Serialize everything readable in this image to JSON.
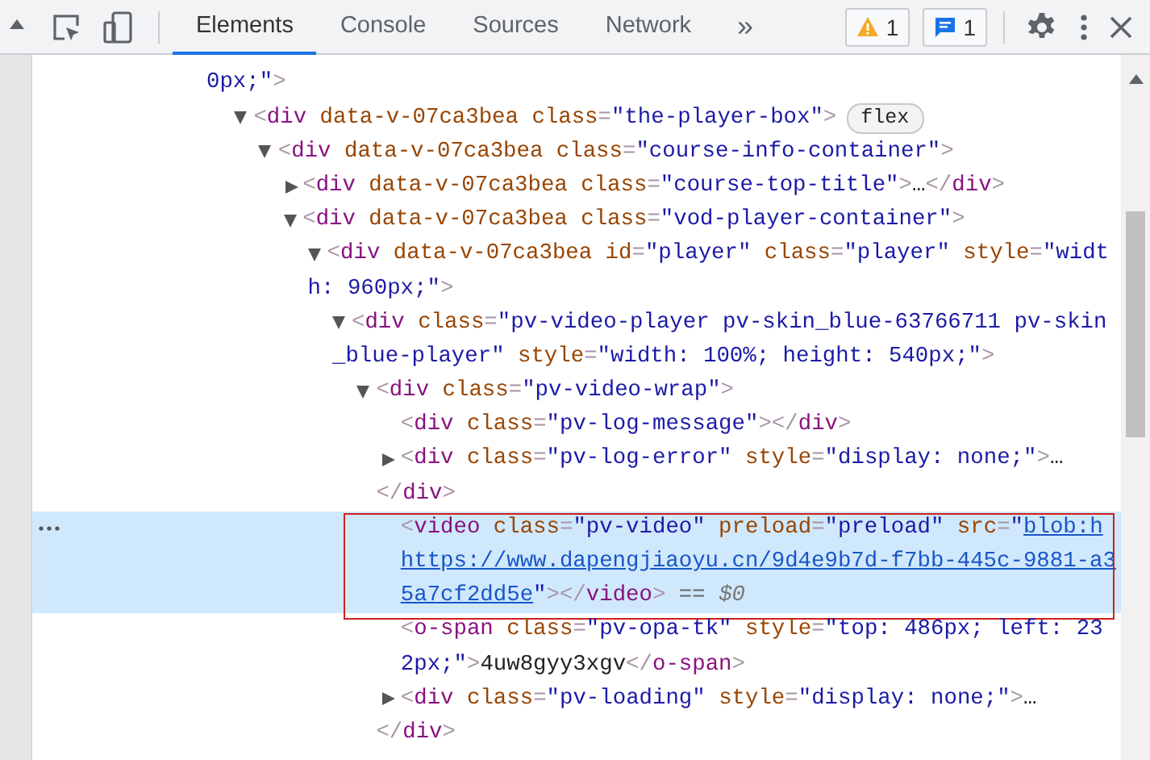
{
  "toolbar": {
    "tabs": [
      {
        "label": "Elements",
        "selected": true
      },
      {
        "label": "Console",
        "selected": false
      },
      {
        "label": "Sources",
        "selected": false
      },
      {
        "label": "Network",
        "selected": false
      }
    ],
    "more": "»",
    "warnings": "1",
    "messages": "1"
  },
  "nodes": [
    {
      "kind": "continuation",
      "selected": false,
      "lines": [
        [
          {
            "kind": "value",
            "text": "0px;\""
          },
          {
            "kind": "punct",
            "text": ">"
          }
        ]
      ],
      "children": [
        {
          "kind": "node",
          "expanded": true,
          "selected": false,
          "badge": "flex",
          "lines": [
            [
              {
                "kind": "punct",
                "text": "<"
              },
              {
                "kind": "tag",
                "text": "div"
              },
              {
                "kind": "attr",
                "text": " data-v-07ca3bea"
              },
              {
                "kind": "attr",
                "text": " class"
              },
              {
                "kind": "punct",
                "text": "="
              },
              {
                "kind": "value",
                "text": "\"the-player-box\""
              },
              {
                "kind": "punct",
                "text": ">"
              }
            ]
          ],
          "children": [
            {
              "kind": "node",
              "expanded": true,
              "selected": false,
              "lines": [
                [
                  {
                    "kind": "punct",
                    "text": "<"
                  },
                  {
                    "kind": "tag",
                    "text": "div"
                  },
                  {
                    "kind": "attr",
                    "text": " data-v-07ca3bea"
                  },
                  {
                    "kind": "attr",
                    "text": " class"
                  },
                  {
                    "kind": "punct",
                    "text": "="
                  },
                  {
                    "kind": "value",
                    "text": "\"course-info-container\""
                  },
                  {
                    "kind": "punct",
                    "text": ">"
                  }
                ]
              ],
              "children": [
                {
                  "kind": "node",
                  "expanded": false,
                  "selected": false,
                  "lines": [
                    [
                      {
                        "kind": "punct",
                        "text": "<"
                      },
                      {
                        "kind": "tag",
                        "text": "div"
                      },
                      {
                        "kind": "attr",
                        "text": " data-v-07ca3bea"
                      },
                      {
                        "kind": "attr",
                        "text": " class"
                      },
                      {
                        "kind": "punct",
                        "text": "="
                      },
                      {
                        "kind": "value",
                        "text": "\"course-top-title\""
                      },
                      {
                        "kind": "punct",
                        "text": ">"
                      },
                      {
                        "kind": "plain",
                        "text": "…"
                      },
                      {
                        "kind": "punct",
                        "text": "</"
                      },
                      {
                        "kind": "tag",
                        "text": "div"
                      },
                      {
                        "kind": "punct",
                        "text": ">"
                      }
                    ]
                  ]
                },
                {
                  "kind": "node",
                  "expanded": true,
                  "selected": false,
                  "lines": [
                    [
                      {
                        "kind": "punct",
                        "text": "<"
                      },
                      {
                        "kind": "tag",
                        "text": "div"
                      },
                      {
                        "kind": "attr",
                        "text": " data-v-07ca3bea"
                      },
                      {
                        "kind": "attr",
                        "text": " class"
                      },
                      {
                        "kind": "punct",
                        "text": "="
                      },
                      {
                        "kind": "value",
                        "text": "\"vod-player-container\""
                      },
                      {
                        "kind": "punct",
                        "text": ">"
                      }
                    ]
                  ],
                  "children": [
                    {
                      "kind": "node",
                      "expanded": true,
                      "selected": false,
                      "lines": [
                        [
                          {
                            "kind": "punct",
                            "text": "<"
                          },
                          {
                            "kind": "tag",
                            "text": "div"
                          },
                          {
                            "kind": "attr",
                            "text": " data-v-07ca3bea"
                          },
                          {
                            "kind": "attr",
                            "text": " id"
                          },
                          {
                            "kind": "punct",
                            "text": "="
                          },
                          {
                            "kind": "value",
                            "text": "\"player\""
                          },
                          {
                            "kind": "attr",
                            "text": " class"
                          },
                          {
                            "kind": "punct",
                            "text": "="
                          },
                          {
                            "kind": "value",
                            "text": "\"player\""
                          },
                          {
                            "kind": "attr",
                            "text": " style"
                          },
                          {
                            "kind": "punct",
                            "text": "="
                          },
                          {
                            "kind": "value",
                            "text": "\"widt"
                          }
                        ],
                        [
                          {
                            "kind": "value",
                            "text": "h: 960px;\""
                          },
                          {
                            "kind": "punct",
                            "text": ">"
                          }
                        ]
                      ],
                      "children": [
                        {
                          "kind": "node",
                          "expanded": true,
                          "selected": false,
                          "lines": [
                            [
                              {
                                "kind": "punct",
                                "text": "<"
                              },
                              {
                                "kind": "tag",
                                "text": "div"
                              },
                              {
                                "kind": "attr",
                                "text": " class"
                              },
                              {
                                "kind": "punct",
                                "text": "="
                              },
                              {
                                "kind": "value",
                                "text": "\"pv-video-player pv-skin_blue-63766711 pv-skin"
                              }
                            ],
                            [
                              {
                                "kind": "value",
                                "text": "_blue-player\""
                              },
                              {
                                "kind": "attr",
                                "text": " style"
                              },
                              {
                                "kind": "punct",
                                "text": "="
                              },
                              {
                                "kind": "value",
                                "text": "\"width: 100%; height: 540px;\""
                              },
                              {
                                "kind": "punct",
                                "text": ">"
                              }
                            ]
                          ],
                          "children": [
                            {
                              "kind": "node",
                              "expanded": true,
                              "selected": false,
                              "lines": [
                                [
                                  {
                                    "kind": "punct",
                                    "text": "<"
                                  },
                                  {
                                    "kind": "tag",
                                    "text": "div"
                                  },
                                  {
                                    "kind": "attr",
                                    "text": " class"
                                  },
                                  {
                                    "kind": "punct",
                                    "text": "="
                                  },
                                  {
                                    "kind": "value",
                                    "text": "\"pv-video-wrap\""
                                  },
                                  {
                                    "kind": "punct",
                                    "text": ">"
                                  }
                                ]
                              ],
                              "children": [
                                {
                                  "kind": "text",
                                  "selected": false,
                                  "lines": [
                                    [
                                      {
                                        "kind": "punct",
                                        "text": "<"
                                      },
                                      {
                                        "kind": "tag",
                                        "text": "div"
                                      },
                                      {
                                        "kind": "attr",
                                        "text": " class"
                                      },
                                      {
                                        "kind": "punct",
                                        "text": "="
                                      },
                                      {
                                        "kind": "value",
                                        "text": "\"pv-log-message\""
                                      },
                                      {
                                        "kind": "punct",
                                        "text": "></"
                                      },
                                      {
                                        "kind": "tag",
                                        "text": "div"
                                      },
                                      {
                                        "kind": "punct",
                                        "text": ">"
                                      }
                                    ]
                                  ]
                                },
                                {
                                  "kind": "node",
                                  "expanded": false,
                                  "selected": false,
                                  "lines": [
                                    [
                                      {
                                        "kind": "punct",
                                        "text": "<"
                                      },
                                      {
                                        "kind": "tag",
                                        "text": "div"
                                      },
                                      {
                                        "kind": "attr",
                                        "text": " class"
                                      },
                                      {
                                        "kind": "punct",
                                        "text": "="
                                      },
                                      {
                                        "kind": "value",
                                        "text": "\"pv-log-error\""
                                      },
                                      {
                                        "kind": "attr",
                                        "text": " style"
                                      },
                                      {
                                        "kind": "punct",
                                        "text": "="
                                      },
                                      {
                                        "kind": "value",
                                        "text": "\"display: none;\""
                                      },
                                      {
                                        "kind": "punct",
                                        "text": ">"
                                      },
                                      {
                                        "kind": "plain",
                                        "text": "…"
                                      }
                                    ]
                                  ]
                                },
                                {
                                  "kind": "close",
                                  "selected": false,
                                  "lines": [
                                    [
                                      {
                                        "kind": "punct",
                                        "text": "</"
                                      },
                                      {
                                        "kind": "tag",
                                        "text": "div"
                                      },
                                      {
                                        "kind": "punct",
                                        "text": ">"
                                      }
                                    ]
                                  ]
                                },
                                {
                                  "kind": "text",
                                  "selected": true,
                                  "annotated": true,
                                  "lines": [
                                    [
                                      {
                                        "kind": "punct",
                                        "text": "<"
                                      },
                                      {
                                        "kind": "tag",
                                        "text": "video"
                                      },
                                      {
                                        "kind": "attr",
                                        "text": " class"
                                      },
                                      {
                                        "kind": "punct",
                                        "text": "="
                                      },
                                      {
                                        "kind": "value",
                                        "text": "\"pv-video\""
                                      },
                                      {
                                        "kind": "attr",
                                        "text": " preload"
                                      },
                                      {
                                        "kind": "punct",
                                        "text": "="
                                      },
                                      {
                                        "kind": "value",
                                        "text": "\"preload\""
                                      },
                                      {
                                        "kind": "attr",
                                        "text": " src"
                                      },
                                      {
                                        "kind": "punct",
                                        "text": "="
                                      },
                                      {
                                        "kind": "value",
                                        "text": "\""
                                      },
                                      {
                                        "kind": "link",
                                        "text": "blob:h"
                                      }
                                    ],
                                    [
                                      {
                                        "kind": "link",
                                        "text": "https://www.dapengjiaoyu.cn/9d4e9b7d-f7bb-445c-9881-a3"
                                      }
                                    ],
                                    [
                                      {
                                        "kind": "link",
                                        "text": "5a7cf2dd5e"
                                      },
                                      {
                                        "kind": "value",
                                        "text": "\""
                                      },
                                      {
                                        "kind": "punct",
                                        "text": "></"
                                      },
                                      {
                                        "kind": "tag",
                                        "text": "video"
                                      },
                                      {
                                        "kind": "punct",
                                        "text": ">"
                                      },
                                      {
                                        "kind": "ref",
                                        "text": " == "
                                      },
                                      {
                                        "kind": "var",
                                        "text": "$0"
                                      }
                                    ]
                                  ]
                                },
                                {
                                  "kind": "text",
                                  "selected": false,
                                  "lines": [
                                    [
                                      {
                                        "kind": "punct",
                                        "text": "<"
                                      },
                                      {
                                        "kind": "tag",
                                        "text": "o-span"
                                      },
                                      {
                                        "kind": "attr",
                                        "text": " class"
                                      },
                                      {
                                        "kind": "punct",
                                        "text": "="
                                      },
                                      {
                                        "kind": "value",
                                        "text": "\"pv-opa-tk\""
                                      },
                                      {
                                        "kind": "attr",
                                        "text": " style"
                                      },
                                      {
                                        "kind": "punct",
                                        "text": "="
                                      },
                                      {
                                        "kind": "value",
                                        "text": "\"top: 486px; left: 23"
                                      }
                                    ],
                                    [
                                      {
                                        "kind": "value",
                                        "text": "2px;\""
                                      },
                                      {
                                        "kind": "punct",
                                        "text": ">"
                                      },
                                      {
                                        "kind": "plain",
                                        "text": "4uw8gyy3xgv"
                                      },
                                      {
                                        "kind": "punct",
                                        "text": "</"
                                      },
                                      {
                                        "kind": "tag",
                                        "text": "o-span"
                                      },
                                      {
                                        "kind": "punct",
                                        "text": ">"
                                      }
                                    ]
                                  ]
                                },
                                {
                                  "kind": "node",
                                  "expanded": false,
                                  "selected": false,
                                  "lines": [
                                    [
                                      {
                                        "kind": "punct",
                                        "text": "<"
                                      },
                                      {
                                        "kind": "tag",
                                        "text": "div"
                                      },
                                      {
                                        "kind": "attr",
                                        "text": " class"
                                      },
                                      {
                                        "kind": "punct",
                                        "text": "="
                                      },
                                      {
                                        "kind": "value",
                                        "text": "\"pv-loading\""
                                      },
                                      {
                                        "kind": "attr",
                                        "text": " style"
                                      },
                                      {
                                        "kind": "punct",
                                        "text": "="
                                      },
                                      {
                                        "kind": "value",
                                        "text": "\"display: none;\""
                                      },
                                      {
                                        "kind": "punct",
                                        "text": ">"
                                      },
                                      {
                                        "kind": "plain",
                                        "text": "…"
                                      }
                                    ]
                                  ]
                                },
                                {
                                  "kind": "close",
                                  "selected": false,
                                  "lines": [
                                    [
                                      {
                                        "kind": "punct",
                                        "text": "</"
                                      },
                                      {
                                        "kind": "tag",
                                        "text": "div"
                                      },
                                      {
                                        "kind": "punct",
                                        "text": ">"
                                      }
                                    ]
                                  ]
                                }
                              ]
                            }
                          ]
                        }
                      ]
                    }
                  ]
                }
              ]
            }
          ]
        }
      ]
    }
  ]
}
